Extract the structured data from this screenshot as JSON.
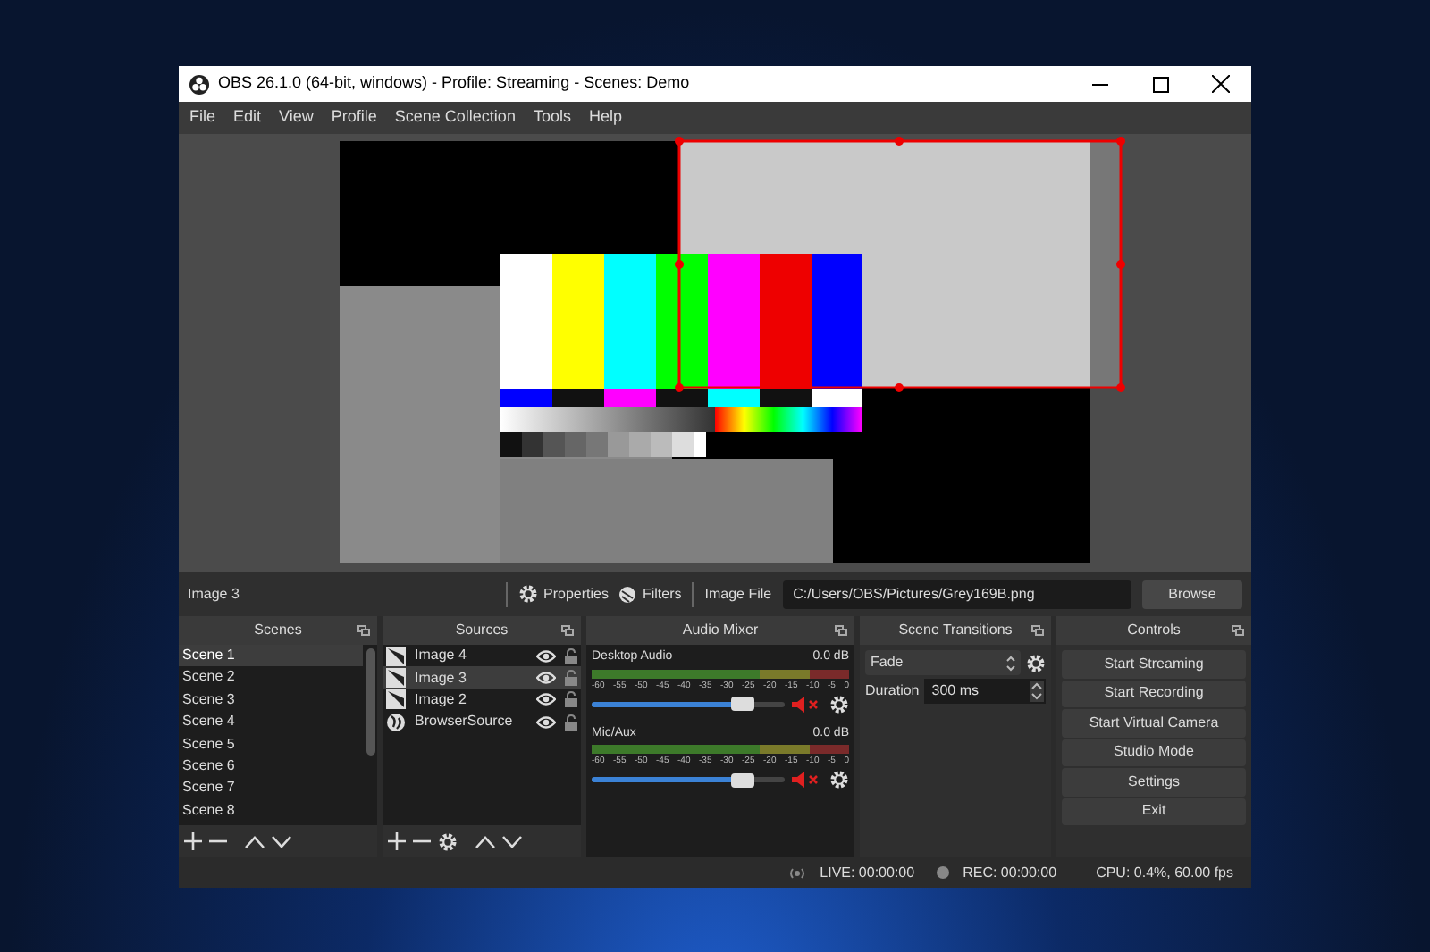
{
  "window": {
    "title": "OBS 26.1.0 (64-bit, windows) - Profile: Streaming - Scenes: Demo"
  },
  "menu": [
    "File",
    "Edit",
    "View",
    "Profile",
    "Scene Collection",
    "Tools",
    "Help"
  ],
  "source_toolbar": {
    "source_name": "Image 3",
    "properties": "Properties",
    "filters": "Filters",
    "field_label": "Image File",
    "field_value": "C:/Users/OBS/Pictures/Grey169B.png",
    "browse": "Browse"
  },
  "scenes": {
    "title": "Scenes",
    "items": [
      {
        "label": "Scene 1",
        "selected": true
      },
      {
        "label": "Scene 2",
        "selected": false
      },
      {
        "label": "Scene 3",
        "selected": false
      },
      {
        "label": "Scene 4",
        "selected": false
      },
      {
        "label": "Scene 5",
        "selected": false
      },
      {
        "label": "Scene 6",
        "selected": false
      },
      {
        "label": "Scene 7",
        "selected": false
      },
      {
        "label": "Scene 8",
        "selected": false
      }
    ]
  },
  "sources": {
    "title": "Sources",
    "items": [
      {
        "label": "Image 4",
        "kind": "image",
        "selected": false
      },
      {
        "label": "Image 3",
        "kind": "image",
        "selected": true
      },
      {
        "label": "Image 2",
        "kind": "image",
        "selected": false
      },
      {
        "label": "BrowserSource",
        "kind": "browser",
        "selected": false
      }
    ]
  },
  "audio_mixer": {
    "title": "Audio Mixer",
    "channels": [
      {
        "name": "Desktop Audio",
        "reading": "0.0 dB",
        "scale": [
          "-60",
          "-55",
          "-50",
          "-45",
          "-40",
          "-35",
          "-30",
          "-25",
          "-20",
          "-15",
          "-10",
          "-5",
          "0"
        ],
        "level": 0.78,
        "muted": true
      },
      {
        "name": "Mic/Aux",
        "reading": "0.0 dB",
        "scale": [
          "-60",
          "-55",
          "-50",
          "-45",
          "-40",
          "-35",
          "-30",
          "-25",
          "-20",
          "-15",
          "-10",
          "-5",
          "0"
        ],
        "level": 0.78,
        "muted": true
      }
    ]
  },
  "scene_transitions": {
    "title": "Scene Transitions",
    "transition": "Fade",
    "duration_label": "Duration",
    "duration": "300 ms"
  },
  "controls": {
    "title": "Controls",
    "buttons": [
      "Start Streaming",
      "Start Recording",
      "Start Virtual Camera",
      "Studio Mode",
      "Settings",
      "Exit"
    ]
  },
  "status_bar": {
    "live": "LIVE: 00:00:00",
    "rec": "REC: 00:00:00",
    "cpu": "CPU: 0.4%, 60.00 fps"
  }
}
